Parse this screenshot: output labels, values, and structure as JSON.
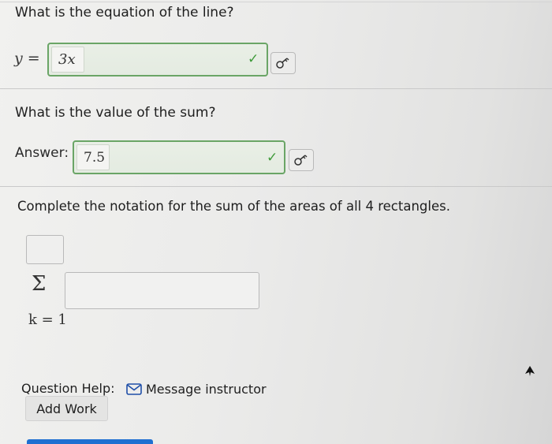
{
  "q1": {
    "text": "What is the equation of the line?",
    "lhs": "y =",
    "value": "3x"
  },
  "q2": {
    "text": "What is the value of the sum?",
    "label": "Answer:",
    "value": "7.5"
  },
  "q3": {
    "text": "Complete the notation for the sum of the areas of all 4 rectangles.",
    "sigma": "Σ",
    "lower_limit": "k = 1"
  },
  "footer": {
    "help_label": "Question Help:",
    "message_link": "Message instructor",
    "add_work": "Add Work"
  },
  "icons": {
    "check": "checkmark-icon",
    "key": "key-icon",
    "envelope": "envelope-icon"
  },
  "colors": {
    "correct_border": "#6aa566",
    "check": "#3f9b3a",
    "primary_button": "#1f6fd1"
  }
}
